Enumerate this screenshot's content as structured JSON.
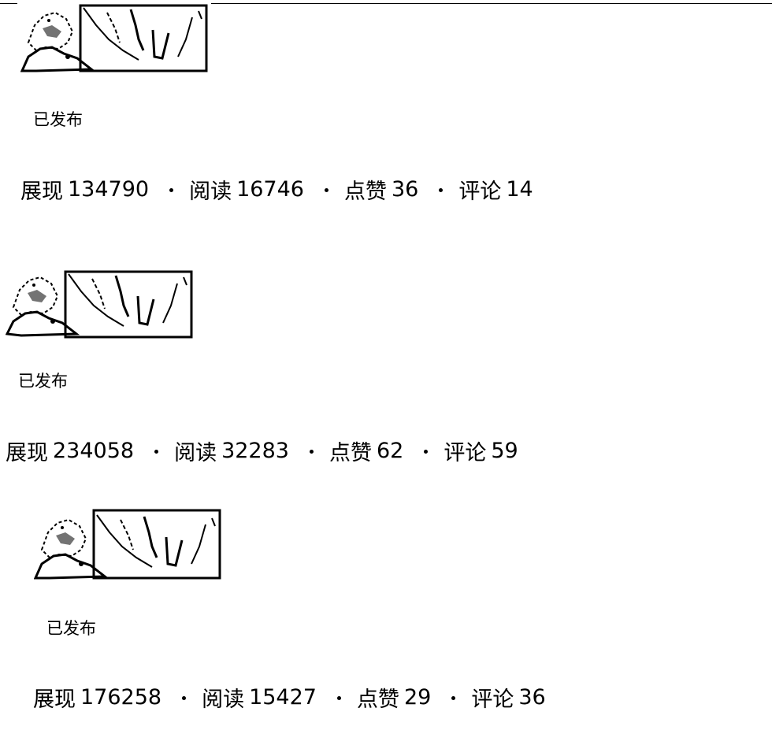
{
  "articles": [
    {
      "status": "已发布",
      "stats": [
        {
          "label": "展现",
          "value": "134790"
        },
        {
          "label": "阅读",
          "value": "16746"
        },
        {
          "label": "点赞",
          "value": "36"
        },
        {
          "label": "评论",
          "value": "14"
        }
      ]
    },
    {
      "status": "已发布",
      "stats": [
        {
          "label": "展现",
          "value": "234058"
        },
        {
          "label": "阅读",
          "value": "32283"
        },
        {
          "label": "点赞",
          "value": "62"
        },
        {
          "label": "评论",
          "value": "59"
        }
      ]
    },
    {
      "status": "已发布",
      "stats": [
        {
          "label": "展现",
          "value": "176258"
        },
        {
          "label": "阅读",
          "value": "15427"
        },
        {
          "label": "点赞",
          "value": "29"
        },
        {
          "label": "评论",
          "value": "36"
        }
      ]
    }
  ]
}
